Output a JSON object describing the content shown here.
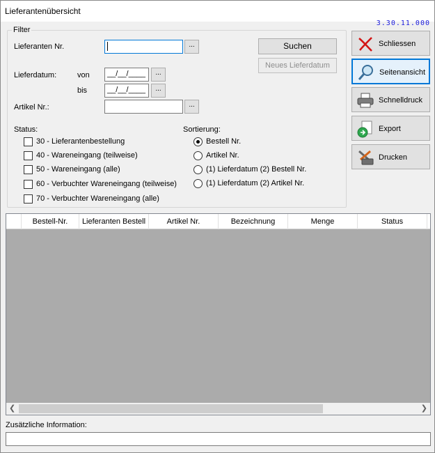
{
  "window": {
    "title": "Lieferantenübersicht",
    "version": "3.30.11.000"
  },
  "filter": {
    "group_title": "Filter",
    "supplier_label": "Lieferanten Nr.",
    "supplier_value": "",
    "delivery_label": "Lieferdatum:",
    "from_label": "von",
    "to_label": "bis",
    "from_value": "__/__/____",
    "to_value": "__/__/____",
    "article_label": "Artikel Nr.:",
    "article_value": "",
    "browse_label": "...",
    "search_button": "Suchen",
    "new_date_button": "Neues Lieferdatum"
  },
  "status": {
    "label": "Status:",
    "items": [
      {
        "label": "30 - Lieferantenbestellung",
        "checked": false
      },
      {
        "label": "40 - Wareneingang (teilweise)",
        "checked": false
      },
      {
        "label": "50 - Wareneingang (alle)",
        "checked": false
      },
      {
        "label": "60 - Verbuchter Wareneingang (teilweise)",
        "checked": false
      },
      {
        "label": "70 - Verbuchter Wareneingang (alle)",
        "checked": false
      }
    ]
  },
  "sort": {
    "label": "Sortierung:",
    "items": [
      {
        "label": "Bestell Nr.",
        "selected": true
      },
      {
        "label": "Artikel Nr.",
        "selected": false
      },
      {
        "label": "(1) Lieferdatum (2) Bestell Nr.",
        "selected": false
      },
      {
        "label": "(1) Lieferdatum (2) Artikel Nr.",
        "selected": false
      }
    ]
  },
  "side": {
    "close": "Schliessen",
    "preview": "Seitenansicht",
    "quickprint": "Schnelldruck",
    "export": "Export",
    "print": "Drucken"
  },
  "grid": {
    "columns": [
      "Bestell-Nr.",
      "Lieferanten Bestell",
      "Artikel Nr.",
      "Bezeichnung",
      "Menge",
      "Status"
    ],
    "rows": []
  },
  "info": {
    "label": "Zusätzliche Information:",
    "value": ""
  },
  "colors": {
    "accent": "#0078d7",
    "version_text": "#1a1adc",
    "grid_bg": "#ababab"
  }
}
